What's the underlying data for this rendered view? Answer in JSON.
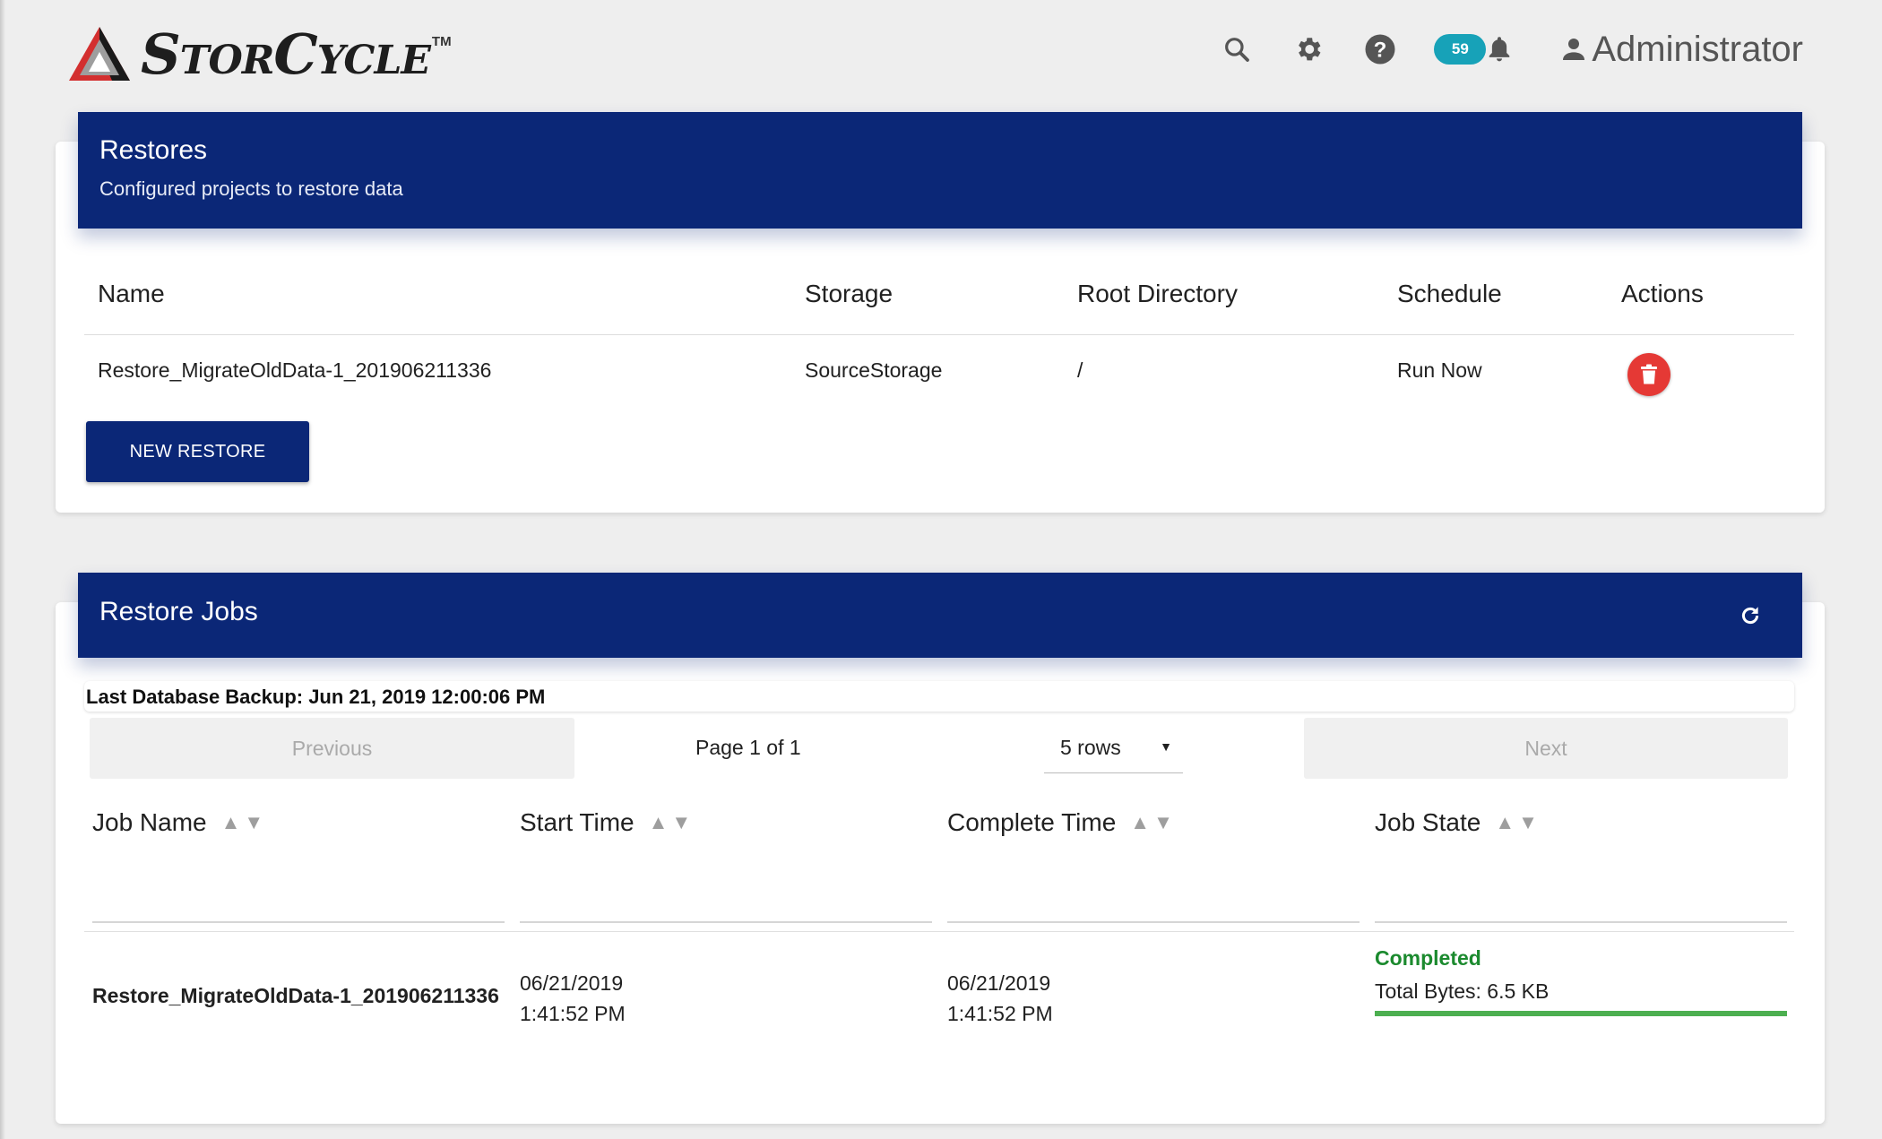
{
  "app": {
    "brand_first": "S",
    "brand_rest1": "TOR",
    "brand_second": "C",
    "brand_rest2": "YCLE",
    "trademark": "TM"
  },
  "header": {
    "icons": [
      "search-icon",
      "gear-icon",
      "help-icon",
      "bell-icon",
      "user-icon"
    ],
    "notification_count": "59",
    "user_name": "Administrator"
  },
  "restores": {
    "title": "Restores",
    "subtitle": "Configured projects to restore data",
    "columns": [
      "Name",
      "Storage",
      "Root Directory",
      "Schedule",
      "Actions"
    ],
    "rows": [
      {
        "name": "Restore_MigrateOldData-1_201906211336",
        "storage": "SourceStorage",
        "root": "/",
        "schedule": "Run Now"
      }
    ],
    "new_button": "NEW RESTORE"
  },
  "jobs": {
    "title": "Restore Jobs",
    "backup": "Last Database Backup: Jun 21, 2019 12:00:06 PM",
    "pager": {
      "previous": "Previous",
      "info": "Page 1 of 1",
      "rows_option": "5 rows",
      "next": "Next"
    },
    "columns": [
      "Job Name",
      "Start Time",
      "Complete Time",
      "Job State"
    ],
    "rows": [
      {
        "name": "Restore_MigrateOldData-1_201906211336",
        "start_date": "06/21/2019",
        "start_time": "1:41:52 PM",
        "complete_date": "06/21/2019",
        "complete_time": "1:41:52 PM",
        "state": "Completed",
        "bytes": "Total Bytes: 6.5 KB",
        "progress": 1.0
      }
    ]
  },
  "colors": {
    "header_blue": "#0b2777",
    "badge": "#17a2b8",
    "delete_red": "#e53935",
    "success_green": "#1b8a2e",
    "progress_green": "#4caf50"
  }
}
